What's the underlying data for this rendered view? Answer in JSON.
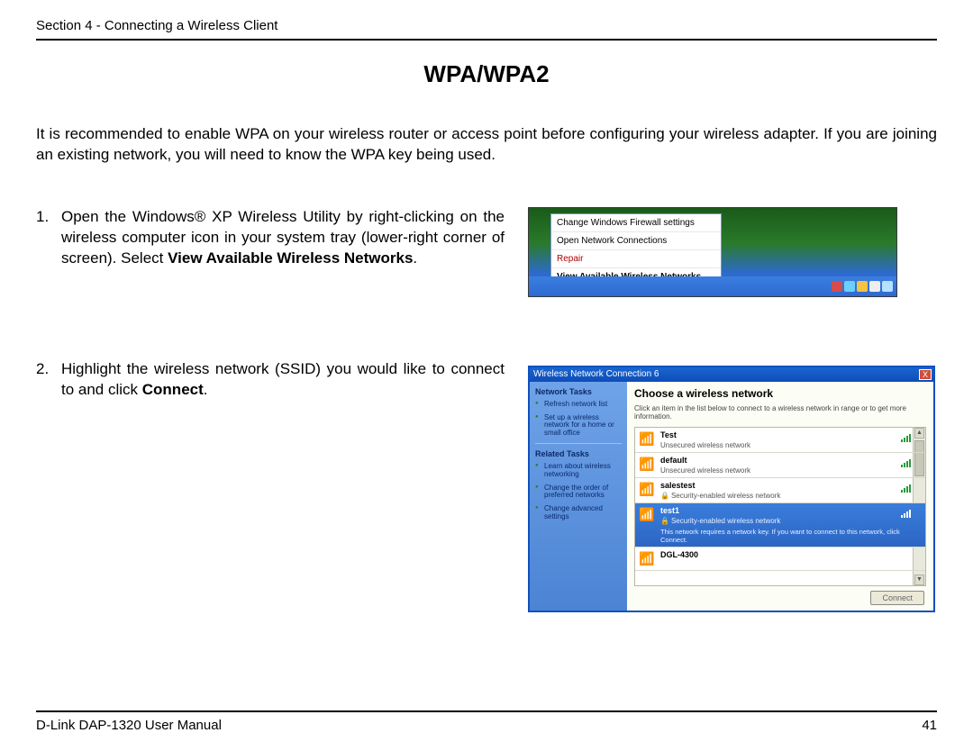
{
  "header": {
    "section": "Section 4 - Connecting a Wireless Client"
  },
  "title": "WPA/WPA2",
  "intro": "It is recommended to enable WPA on your wireless router or access point before configuring your wireless adapter. If you are joining an existing network, you will need to know the WPA key being used.",
  "steps": [
    {
      "num": "1.",
      "pre": "Open the Windows® XP Wireless Utility by right-clicking on the wireless computer icon in your system tray (lower-right corner of screen). Select ",
      "bold": "View Available Wireless Networks",
      "post": "."
    },
    {
      "num": "2.",
      "pre": "Highlight the wireless network (SSID) you would like to connect to and click ",
      "bold": "Connect",
      "post": "."
    }
  ],
  "fig1": {
    "menu": [
      {
        "label": "Change Windows Firewall settings",
        "style": ""
      },
      {
        "label": "Open Network Connections",
        "style": ""
      },
      {
        "label": "Repair",
        "style": "red"
      },
      {
        "label": "View Available Wireless Networks",
        "style": "boldb"
      }
    ]
  },
  "fig2": {
    "title": "Wireless Network Connection 6",
    "side": {
      "sect1": "Network Tasks",
      "links1": [
        "Refresh network list",
        "Set up a wireless network for a home or small office"
      ],
      "sect2": "Related Tasks",
      "links2": [
        "Learn about wireless networking",
        "Change the order of preferred networks",
        "Change advanced settings"
      ]
    },
    "main": {
      "heading": "Choose a wireless network",
      "sub": "Click an item in the list below to connect to a wireless network in range or to get more information.",
      "networks": [
        {
          "ssid": "Test",
          "desc": "Unsecured wireless network",
          "secure": false
        },
        {
          "ssid": "default",
          "desc": "Unsecured wireless network",
          "secure": false
        },
        {
          "ssid": "salestest",
          "desc": "Security-enabled wireless network",
          "secure": true
        },
        {
          "ssid": "test1",
          "desc": "Security-enabled wireless network",
          "secure": true,
          "selected": true,
          "extra": "This network requires a network key. If you want to connect to this network, click Connect."
        },
        {
          "ssid": "DGL-4300",
          "desc": "",
          "secure": false
        }
      ],
      "button": "Connect"
    }
  },
  "footer": {
    "left": "D-Link DAP-1320 User Manual",
    "right": "41"
  }
}
